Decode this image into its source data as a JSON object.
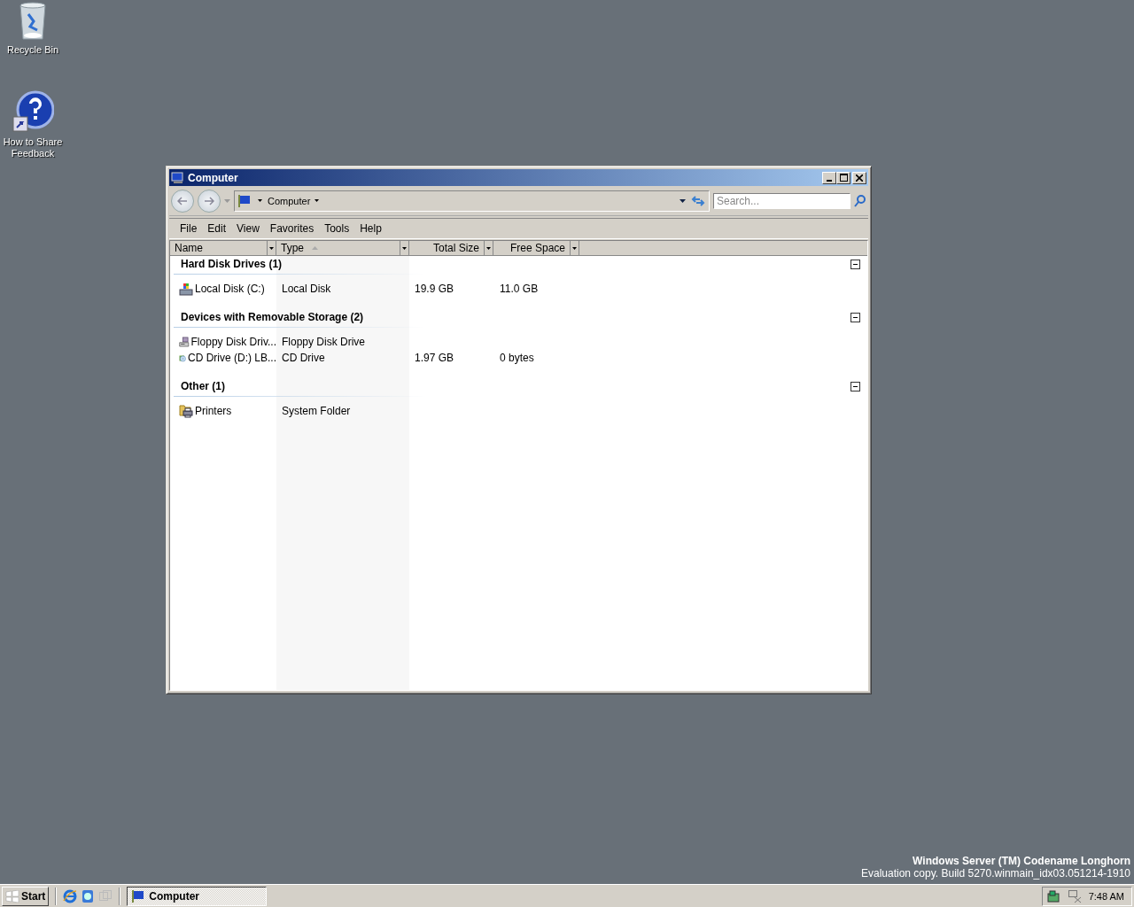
{
  "desktop_icons": [
    {
      "label": "Recycle Bin",
      "kind": "recycle-bin"
    },
    {
      "label": "How to Share Feedback",
      "kind": "help-shortcut"
    }
  ],
  "window": {
    "title": "Computer",
    "address": [
      "Computer"
    ],
    "search": {
      "placeholder": "Search..."
    },
    "menu": [
      "File",
      "Edit",
      "View",
      "Favorites",
      "Tools",
      "Help"
    ],
    "columns": [
      {
        "label": "Name",
        "sorted": false
      },
      {
        "label": "Type",
        "sorted": true
      },
      {
        "label": "Total Size",
        "sorted": false
      },
      {
        "label": "Free Space",
        "sorted": false
      }
    ],
    "groups": [
      {
        "title": "Hard Disk Drives (1)",
        "expanded": true,
        "items": [
          {
            "name": "Local Disk (C:)",
            "type": "Local Disk",
            "total_size": "19.9 GB",
            "free_space": "11.0 GB",
            "kind": "hard-disk"
          }
        ]
      },
      {
        "title": "Devices with Removable Storage (2)",
        "expanded": true,
        "items": [
          {
            "name": "Floppy Disk Driv...",
            "type": "Floppy Disk Drive",
            "kind": "floppy"
          },
          {
            "name": "CD Drive (D:) LB...",
            "type": "CD Drive",
            "total_size": "1.97 GB",
            "free_space": "0 bytes",
            "kind": "cd"
          }
        ]
      },
      {
        "title": "Other (1)",
        "expanded": true,
        "items": [
          {
            "name": "Printers",
            "type": "System Folder",
            "kind": "printer"
          }
        ]
      }
    ]
  },
  "branding": {
    "title": "Windows Server (TM) Codename Longhorn",
    "build": "Evaluation copy. Build 5270.winmain_idx03.051214-1910"
  },
  "taskbar": {
    "start": "Start",
    "tasks": [
      {
        "label": "Computer",
        "selected": true
      }
    ],
    "clock": "7:48 AM"
  }
}
